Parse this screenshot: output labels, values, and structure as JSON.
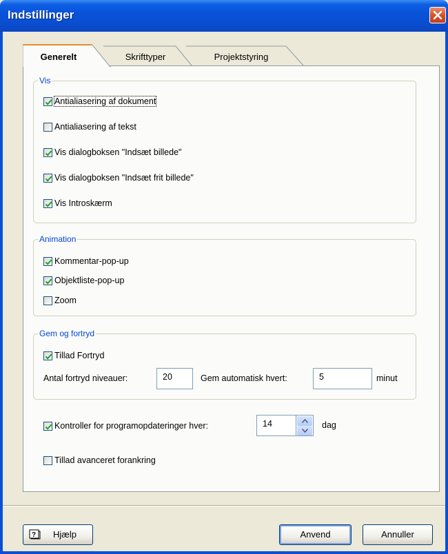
{
  "window": {
    "title": "Indstillinger"
  },
  "tabs": [
    {
      "label": "Generelt",
      "active": true
    },
    {
      "label": "Skrifttyper",
      "active": false
    },
    {
      "label": "Projektstyring",
      "active": false
    }
  ],
  "groups": {
    "vis": {
      "legend": "Vis",
      "items": [
        {
          "label": "Antialiasering af dokument",
          "checked": true
        },
        {
          "label": "Antialiasering af tekst",
          "checked": false
        },
        {
          "label": "Vis dialogboksen \"Indsæt billede\"",
          "checked": true
        },
        {
          "label": "Vis dialogboksen \"Indsæt frit billede\"",
          "checked": true
        },
        {
          "label": "Vis Introskærm",
          "checked": true
        }
      ]
    },
    "animation": {
      "legend": "Animation",
      "items": [
        {
          "label": "Kommentar-pop-up",
          "checked": true
        },
        {
          "label": "Objektliste-pop-up",
          "checked": true
        },
        {
          "label": "Zoom",
          "checked": false
        }
      ]
    },
    "gem": {
      "legend": "Gem og fortryd",
      "allow_undo": {
        "label": "Tillad Fortryd",
        "checked": true
      },
      "undo_levels_label": "Antal fortryd niveauer:",
      "undo_levels_value": "20",
      "autosave_label": "Gem automatisk hvert:",
      "autosave_value": "5",
      "autosave_unit": "minut"
    }
  },
  "updates": {
    "label": "Kontroller for programopdateringer hver:",
    "checked": true,
    "value": "14",
    "unit": "dag"
  },
  "advanced_docking": {
    "label": "Tillad avanceret forankring",
    "checked": false
  },
  "buttons": {
    "help": "Hjælp",
    "apply": "Anvend",
    "cancel": "Annuller"
  },
  "colors": {
    "titlebar": "#0953da",
    "legend": "#0046d5",
    "check": "#21a121",
    "close": "#d6522b"
  }
}
